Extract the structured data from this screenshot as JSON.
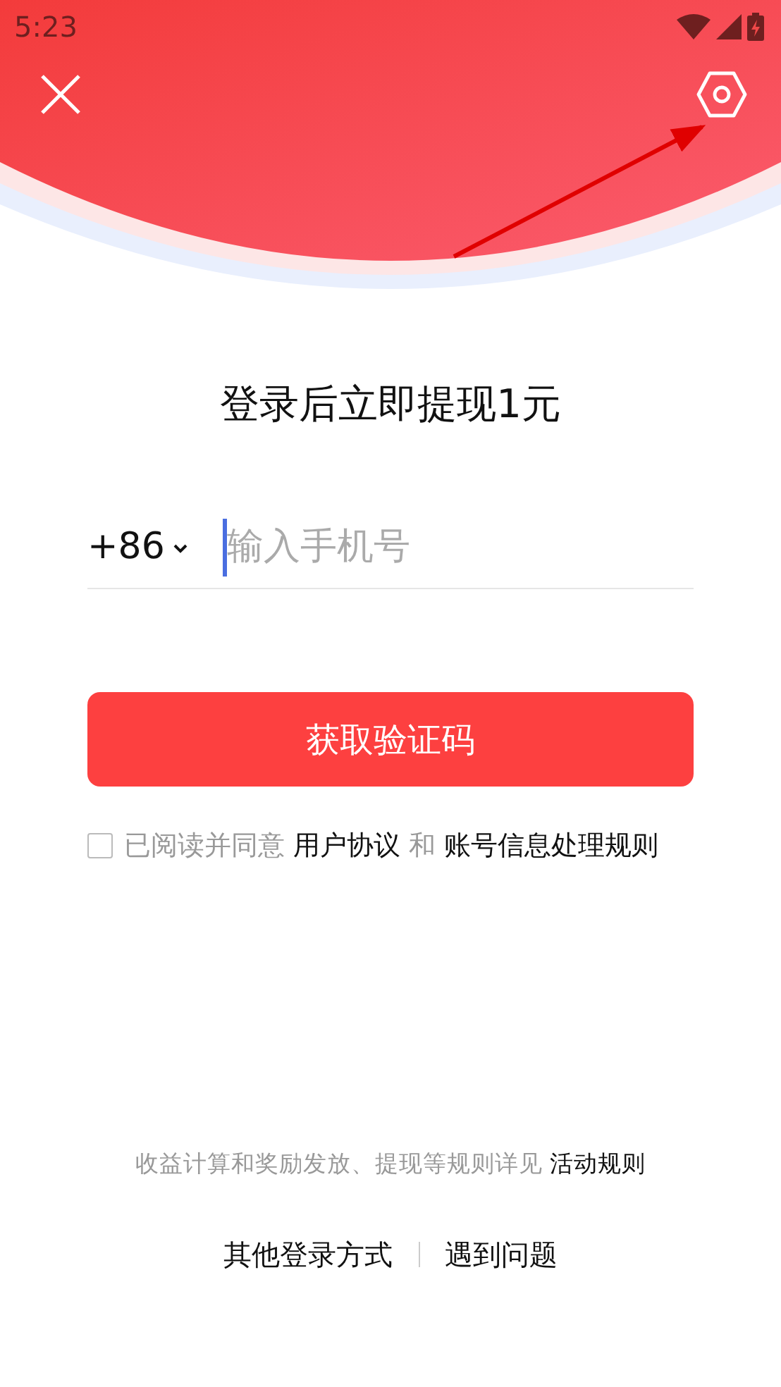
{
  "status_bar": {
    "time": "5:23"
  },
  "title": "登录后立即提现1元",
  "phone": {
    "country_code": "+86",
    "placeholder": "输入手机号"
  },
  "submit_button": "获取验证码",
  "agreement": {
    "checked": false,
    "parts": [
      {
        "kind": "plain",
        "text": "已阅读并同意 "
      },
      {
        "kind": "link",
        "text": "用户协议"
      },
      {
        "kind": "plain",
        "text": " 和 "
      },
      {
        "kind": "link",
        "text": "账号信息处理规则"
      }
    ]
  },
  "rules_note": {
    "parts": [
      {
        "kind": "plain",
        "text": "收益计算和奖励发放、提现等规则详见 "
      },
      {
        "kind": "link",
        "text": "活动规则"
      }
    ]
  },
  "footer_links": [
    "其他登录方式",
    "遇到问题"
  ]
}
